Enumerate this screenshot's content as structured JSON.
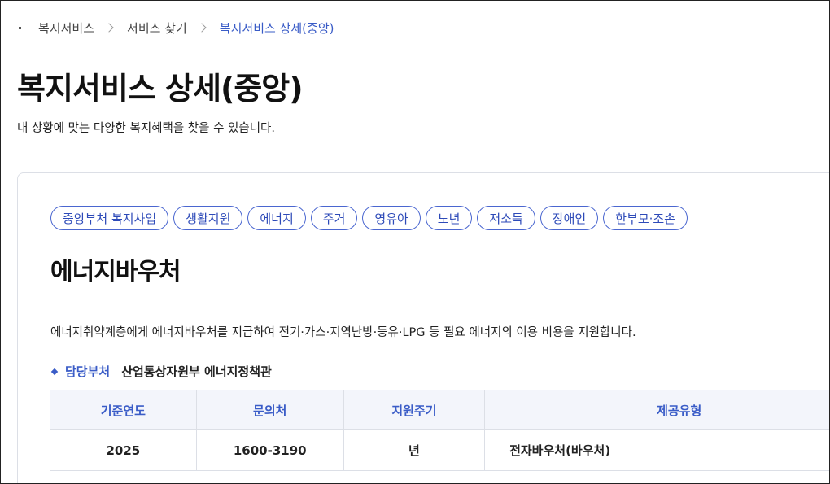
{
  "breadcrumb": {
    "items": [
      "복지서비스",
      "서비스 찾기"
    ],
    "current": "복지서비스 상세(중앙)"
  },
  "page": {
    "title": "복지서비스 상세(중앙)",
    "subtitle": "내 상황에 맞는 다양한 복지혜택을 찾을 수 있습니다."
  },
  "service": {
    "tags": [
      "중앙부처 복지사업",
      "생활지원",
      "에너지",
      "주거",
      "영유아",
      "노년",
      "저소득",
      "장애인",
      "한부모·조손"
    ],
    "name": "에너지바우처",
    "description": "에너지취약계층에게 에너지바우처를 지급하여 전기·가스·지역난방·등유·LPG 등 필요 에너지의 이용 비용을 지원합니다.",
    "department_label": "담당부처",
    "department": "산업통상자원부 에너지정책관"
  },
  "table": {
    "headers": [
      "기준연도",
      "문의처",
      "지원주기",
      "제공유형"
    ],
    "row": [
      "2025",
      "1600-3190",
      "년",
      "전자바우처(바우처)"
    ]
  },
  "colors": {
    "accent": "#3a5cc7",
    "tag_border": "#4a66d0",
    "header_bg": "#f3f5fb"
  }
}
